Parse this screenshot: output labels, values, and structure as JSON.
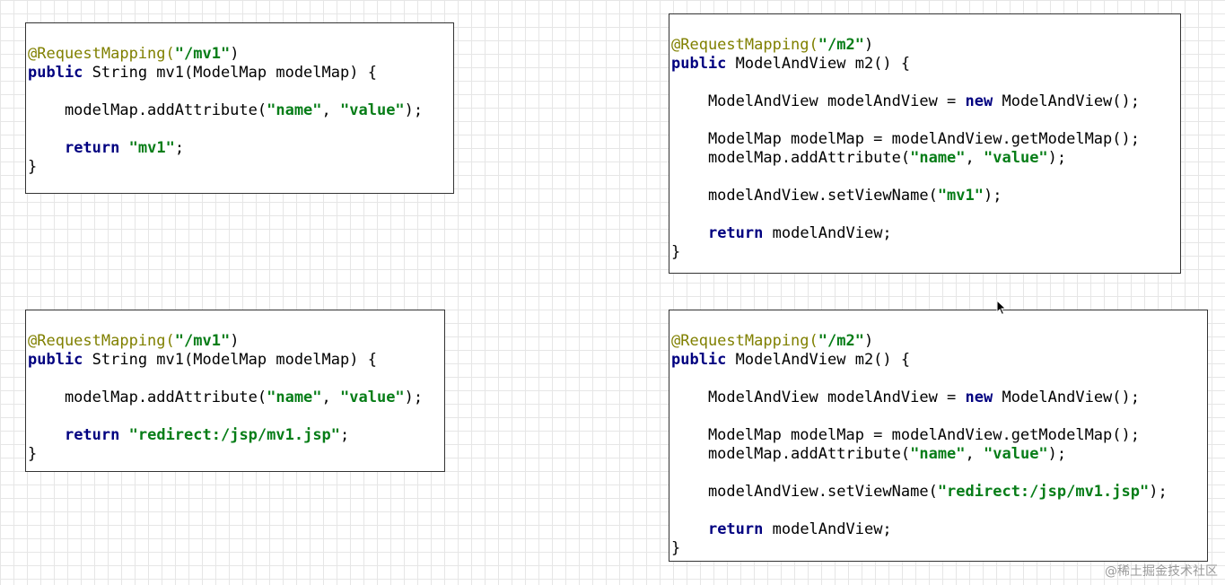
{
  "boxes": [
    {
      "id": "mv1-forward",
      "lines": [
        [
          {
            "t": "@RequestMapping(",
            "c": "ann"
          },
          {
            "t": "\"/mv1\"",
            "c": "str"
          },
          {
            "t": ")",
            "c": "plain"
          }
        ],
        [
          {
            "t": "public",
            "c": "kw"
          },
          {
            "t": " String mv1(ModelMap modelMap) {",
            "c": "plain"
          }
        ],
        [],
        [
          {
            "t": "    modelMap.addAttribute(",
            "c": "plain"
          },
          {
            "t": "\"name\"",
            "c": "str"
          },
          {
            "t": ", ",
            "c": "plain"
          },
          {
            "t": "\"value\"",
            "c": "str"
          },
          {
            "t": ");",
            "c": "plain"
          }
        ],
        [],
        [
          {
            "t": "    ",
            "c": "plain"
          },
          {
            "t": "return",
            "c": "kw"
          },
          {
            "t": " ",
            "c": "plain"
          },
          {
            "t": "\"mv1\"",
            "c": "str"
          },
          {
            "t": ";",
            "c": "plain"
          }
        ],
        [
          {
            "t": "}",
            "c": "plain"
          }
        ]
      ]
    },
    {
      "id": "m2-forward",
      "lines": [
        [
          {
            "t": "@RequestMapping(",
            "c": "ann"
          },
          {
            "t": "\"/m2\"",
            "c": "str"
          },
          {
            "t": ")",
            "c": "plain"
          }
        ],
        [
          {
            "t": "public",
            "c": "kw"
          },
          {
            "t": " ModelAndView m2() {",
            "c": "plain"
          }
        ],
        [],
        [
          {
            "t": "    ModelAndView modelAndView = ",
            "c": "plain"
          },
          {
            "t": "new",
            "c": "kw"
          },
          {
            "t": " ModelAndView();",
            "c": "plain"
          }
        ],
        [],
        [
          {
            "t": "    ModelMap modelMap = modelAndView.getModelMap();",
            "c": "plain"
          }
        ],
        [
          {
            "t": "    modelMap.addAttribute(",
            "c": "plain"
          },
          {
            "t": "\"name\"",
            "c": "str"
          },
          {
            "t": ", ",
            "c": "plain"
          },
          {
            "t": "\"value\"",
            "c": "str"
          },
          {
            "t": ");",
            "c": "plain"
          }
        ],
        [],
        [
          {
            "t": "    modelAndView.setViewName(",
            "c": "plain"
          },
          {
            "t": "\"mv1\"",
            "c": "str"
          },
          {
            "t": ");",
            "c": "plain"
          }
        ],
        [],
        [
          {
            "t": "    ",
            "c": "plain"
          },
          {
            "t": "return",
            "c": "kw"
          },
          {
            "t": " modelAndView;",
            "c": "plain"
          }
        ],
        [
          {
            "t": "}",
            "c": "plain"
          }
        ]
      ]
    },
    {
      "id": "mv1-redirect",
      "lines": [
        [
          {
            "t": "@RequestMapping(",
            "c": "ann"
          },
          {
            "t": "\"/mv1\"",
            "c": "str"
          },
          {
            "t": ")",
            "c": "plain"
          }
        ],
        [
          {
            "t": "public",
            "c": "kw"
          },
          {
            "t": " String mv1(ModelMap modelMap) {",
            "c": "plain"
          }
        ],
        [],
        [
          {
            "t": "    modelMap.addAttribute(",
            "c": "plain"
          },
          {
            "t": "\"name\"",
            "c": "str"
          },
          {
            "t": ", ",
            "c": "plain"
          },
          {
            "t": "\"value\"",
            "c": "str"
          },
          {
            "t": ");",
            "c": "plain"
          }
        ],
        [],
        [
          {
            "t": "    ",
            "c": "plain"
          },
          {
            "t": "return",
            "c": "kw"
          },
          {
            "t": " ",
            "c": "plain"
          },
          {
            "t": "\"redirect:/jsp/mv1.jsp\"",
            "c": "str"
          },
          {
            "t": ";",
            "c": "plain"
          }
        ],
        [
          {
            "t": "}",
            "c": "plain"
          }
        ]
      ]
    },
    {
      "id": "m2-redirect",
      "lines": [
        [
          {
            "t": "@RequestMapping(",
            "c": "ann"
          },
          {
            "t": "\"/m2\"",
            "c": "str"
          },
          {
            "t": ")",
            "c": "plain"
          }
        ],
        [
          {
            "t": "public",
            "c": "kw"
          },
          {
            "t": " ModelAndView m2() {",
            "c": "plain"
          }
        ],
        [],
        [
          {
            "t": "    ModelAndView modelAndView = ",
            "c": "plain"
          },
          {
            "t": "new",
            "c": "kw"
          },
          {
            "t": " ModelAndView();",
            "c": "plain"
          }
        ],
        [],
        [
          {
            "t": "    ModelMap modelMap = modelAndView.getModelMap();",
            "c": "plain"
          }
        ],
        [
          {
            "t": "    modelMap.addAttribute(",
            "c": "plain"
          },
          {
            "t": "\"name\"",
            "c": "str"
          },
          {
            "t": ", ",
            "c": "plain"
          },
          {
            "t": "\"value\"",
            "c": "str"
          },
          {
            "t": ");",
            "c": "plain"
          }
        ],
        [],
        [
          {
            "t": "    modelAndView.setViewName(",
            "c": "plain"
          },
          {
            "t": "\"redirect:/jsp/mv1.jsp\"",
            "c": "str"
          },
          {
            "t": ");",
            "c": "plain"
          }
        ],
        [],
        [
          {
            "t": "    ",
            "c": "plain"
          },
          {
            "t": "return",
            "c": "kw"
          },
          {
            "t": " modelAndView;",
            "c": "plain"
          }
        ],
        [
          {
            "t": "}",
            "c": "plain"
          }
        ]
      ]
    }
  ],
  "colors": {
    "annotation": "#808000",
    "keyword": "#000080",
    "string": "#067d17",
    "plain": "#000000",
    "grid": "#e6e6e6"
  },
  "cursor_icon": "mouse-pointer-icon",
  "watermark": "@稀土掘金技术社区"
}
